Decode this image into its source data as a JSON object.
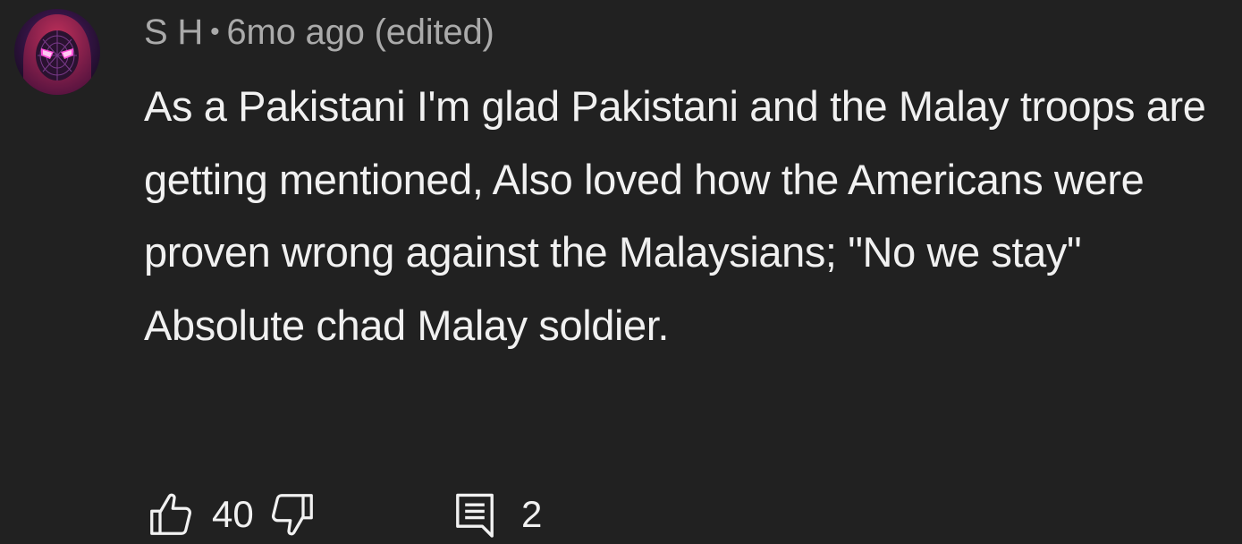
{
  "comment": {
    "author": "S H",
    "separator": "•",
    "time": "6mo ago (edited)",
    "text": "As a Pakistani I'm glad Pakistani and the Malay troops are getting mentioned, Also loved how the Americans were proven wrong against the Malaysians; \"No we stay\" Absolute chad Malay soldier.",
    "avatar_icon": "spider-man-avatar",
    "colors": {
      "background": "#212121",
      "text": "#f1f1f1",
      "meta": "#aaaaaa"
    }
  },
  "actions": {
    "like_icon": "thumbs-up-icon",
    "like_count": "40",
    "dislike_icon": "thumbs-down-icon",
    "reply_icon": "reply-icon",
    "reply_count": "2"
  }
}
